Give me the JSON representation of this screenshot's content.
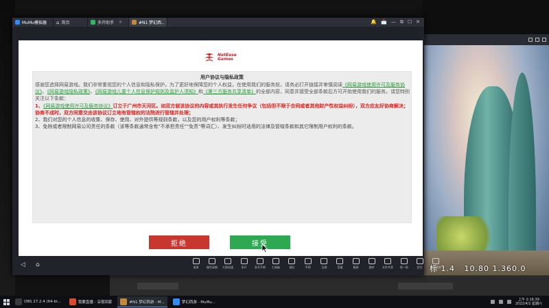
{
  "emulator": {
    "tabs": [
      {
        "label": "MuMu模拟器",
        "color": "#2f8cf0"
      },
      {
        "label": "首页"
      },
      {
        "label": "多开助手",
        "color": "#33b565"
      },
      {
        "label": "#N1 梦幻西..",
        "color": "#c8863a"
      }
    ],
    "window_controls": [
      "🔔",
      "📩",
      "—",
      "⧉",
      "☐",
      "✕"
    ],
    "toolbar": [
      {
        "label": "录屏",
        "icon": "record-icon"
      },
      {
        "label": "操作录制",
        "icon": "macro-icon"
      },
      {
        "label": "大屏加速",
        "icon": "boost-icon"
      },
      {
        "label": "多开",
        "icon": "multi-icon"
      },
      {
        "label": "多开手柄",
        "icon": "gamepad-icon"
      },
      {
        "label": "工具箱",
        "icon": "toolbox-icon"
      },
      {
        "label": "键位",
        "icon": "keyboard-icon"
      },
      {
        "label": "手柄",
        "icon": "controller-icon"
      },
      {
        "label": "全屏",
        "icon": "fullscreen-icon"
      },
      {
        "label": "音量",
        "icon": "volume-icon"
      },
      {
        "label": "截屏",
        "icon": "screenshot-icon"
      },
      {
        "label": "旋转",
        "icon": "rotate-icon"
      },
      {
        "label": "文件共享",
        "icon": "share-icon"
      },
      {
        "label": "摇一摇",
        "icon": "shake-icon"
      },
      {
        "label": "定位",
        "icon": "location-icon"
      },
      {
        "label": "屏幕旋转",
        "icon": "screen-rotate-icon"
      }
    ]
  },
  "dialog": {
    "logo_text_line1": "NetEase",
    "logo_text_line2": "Games",
    "title": "用户协议与隐私政策",
    "intro": "感谢您选择网易游戏。我们非常重视您的个人信息和隐私保护。为了更好地保障您的个人权益，在使用我们的服务前，请务必打开链接并审慎阅读",
    "link1": "《网易游戏使用许可及服务协议》",
    "sep1": "、",
    "link2": "《网易游戏隐私政策》",
    "sep2": "、",
    "link3": "《网易游戏儿童个人信息保护规则及监护人须知》",
    "sep3": "和",
    "link4": "《第三方服务共享清单》",
    "intro_end": "的全部内容，同意并接受全部条款后方可开始使用我们的服务。请您特别关注以下条款：",
    "item1_prefix": "1、",
    "item1_link": "《网易游戏使用许可及服务协议》",
    "item1_red": "订立于广州市天河区。如双方就该协议的内容或其执行发生任何争议（包括但不限于合同或者其他财产性权益纠纷），双方应友好协商解决；协商不成时，双方同意交由该协议订立地有管辖权的法院进行管辖并处理；",
    "item2": "2、我们对您的个人信息的收集、保存、使用、对外提供等规则条款，以及您的用户权利等条款；",
    "item3": "3、免除或者限制网易公司责任的条款（该等条款通常含有\"不承担责任\"\"免责\"等词汇）、发生纠纷时适用的法律及管辖条款和其它限制用户权利的条款。",
    "reject_label": "拒绝",
    "accept_label": "接受"
  },
  "game": {
    "coords": "标 1.4   10.80 1.360.0"
  },
  "taskbar": {
    "items": [
      {
        "label": "OBS 27.2.4 (64-bi...",
        "color": "#3a3a3a"
      },
      {
        "label": "我要直播 - 深夜回家",
        "color": "#d84a2a"
      },
      {
        "label": "#N1 梦幻西游 - M...",
        "color": "#c8863a",
        "active": true
      },
      {
        "label": "梦幻西游 - MuMu...",
        "color": "#2f8cf0"
      }
    ],
    "time": "上午 2:16:39",
    "date": "2022/4/2 星期六"
  }
}
